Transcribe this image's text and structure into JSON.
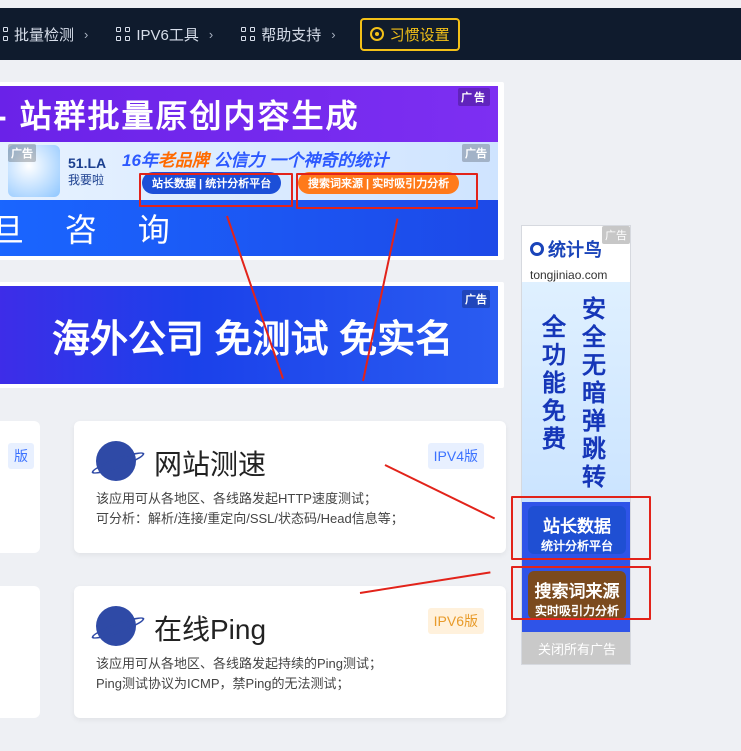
{
  "nav": {
    "items": [
      {
        "label": "批量检测",
        "chevron": "›"
      },
      {
        "label": "IPV6工具",
        "chevron": "›"
      },
      {
        "label": "帮助支持",
        "chevron": "›"
      }
    ],
    "habit_label": "习惯设置"
  },
  "ads": {
    "tag": "广告",
    "purple_text": "- 站群批量原创内容生成",
    "la": {
      "brand": "51.LA",
      "brand_sub": "我要啦",
      "slogan_left": "16年",
      "slogan_mid": "老品牌",
      "slogan_right": "公信力  一个神奇的统计",
      "btn1": "站长数据 | 统计分析平台",
      "btn2": "搜索词来源 | 实时吸引力分析"
    },
    "blue_text": "旦 咨 询",
    "overseas_text": "海外公司  免测试  免实名"
  },
  "cards": [
    {
      "title": "网站测速",
      "badge": "IPV4版",
      "desc1": "该应用可从各地区、各线路发起HTTP速度测试；",
      "desc2": "可分析：解析/连接/重定向/SSL/状态码/Head信息等；"
    },
    {
      "title": "在线Ping",
      "badge": "IPV6版",
      "desc1": "该应用可从各地区、各线路发起持续的Ping测试；",
      "desc2": "Ping测试协议为ICMP，禁Ping的无法测试；"
    }
  ],
  "left_badge": "版",
  "side_ad": {
    "brand": "统计鸟",
    "domain": "tongjiniao.com",
    "v1": "全功能免费",
    "v2": "安全无暗弹跳转",
    "card1_big": "站长数据",
    "card1_small": "统计分析平台",
    "card2_big": "搜索词来源",
    "card2_small": "实时吸引力分析",
    "close_label": "关闭所有广告"
  },
  "colors": {
    "annotation": "#e2231a",
    "nav_bg": "#0f1b2d",
    "habit": "#f3c118"
  }
}
